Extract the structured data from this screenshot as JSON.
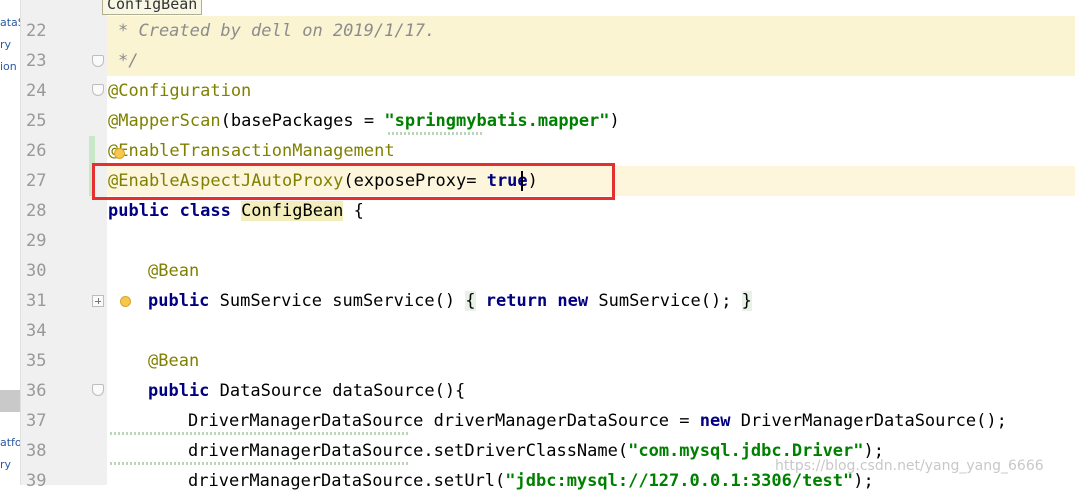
{
  "tooltip": "ConfigBean",
  "left_panel": [
    "ataS",
    "ry",
    "ion",
    "atfo",
    "ry"
  ],
  "gutter": {
    "line_numbers": [
      "22",
      "23",
      "24",
      "25",
      "26",
      "27",
      "28",
      "29",
      "30",
      "31",
      "34",
      "35",
      "36",
      "37",
      "38",
      "39"
    ]
  },
  "code": {
    "l22": "* Created by dell on 2019/1/17.",
    "l23": "*/",
    "l24": "@Configuration",
    "l25_ann": "@MapperScan",
    "l25_open": "(basePackages = ",
    "l25_str": "\"springmybatis.mapper\"",
    "l25_close": ")",
    "l26": "@EnableTransactionManagement",
    "l27_ann": "@EnableAspectJAutoProxy",
    "l27_mid": "(exposeProxy= ",
    "l27_kw": "true",
    "l27_close": ")",
    "l28_kw": "public class ",
    "l28_cls": "ConfigBean",
    "l28_rest": " {",
    "l30": "@Bean",
    "l31_kw1": "public ",
    "l31_mid": "SumService sumService() ",
    "l31_ob": "{",
    "l31_kw2": " return new ",
    "l31_rest": "SumService(); ",
    "l31_cb": "}",
    "l35": "@Bean",
    "l36_kw": "public ",
    "l36_rest": "DataSource dataSource(){",
    "l37_a": "DriverManagerDataSource driverManagerDataSource = ",
    "l37_kw": "new",
    "l37_b": " DriverManagerDataSource();",
    "l38_a": "driverManagerDataSource.setDriverClassName(",
    "l38_str": "\"com.mysql.jdbc.Driver\"",
    "l38_b": ");",
    "l39_a": "driverManagerDataSource.setUrl(",
    "l39_str": "\"jdbc:mysql://127.0.0.1:3306/test\"",
    "l39_b": ");"
  },
  "watermark": "https://blog.csdn.net/yang_yang_6666",
  "colors": {
    "annotation": "#808000",
    "keyword": "#000080",
    "string": "#008000",
    "doc_comment": "#8c8c8c",
    "highlight_box": "#e53030"
  }
}
